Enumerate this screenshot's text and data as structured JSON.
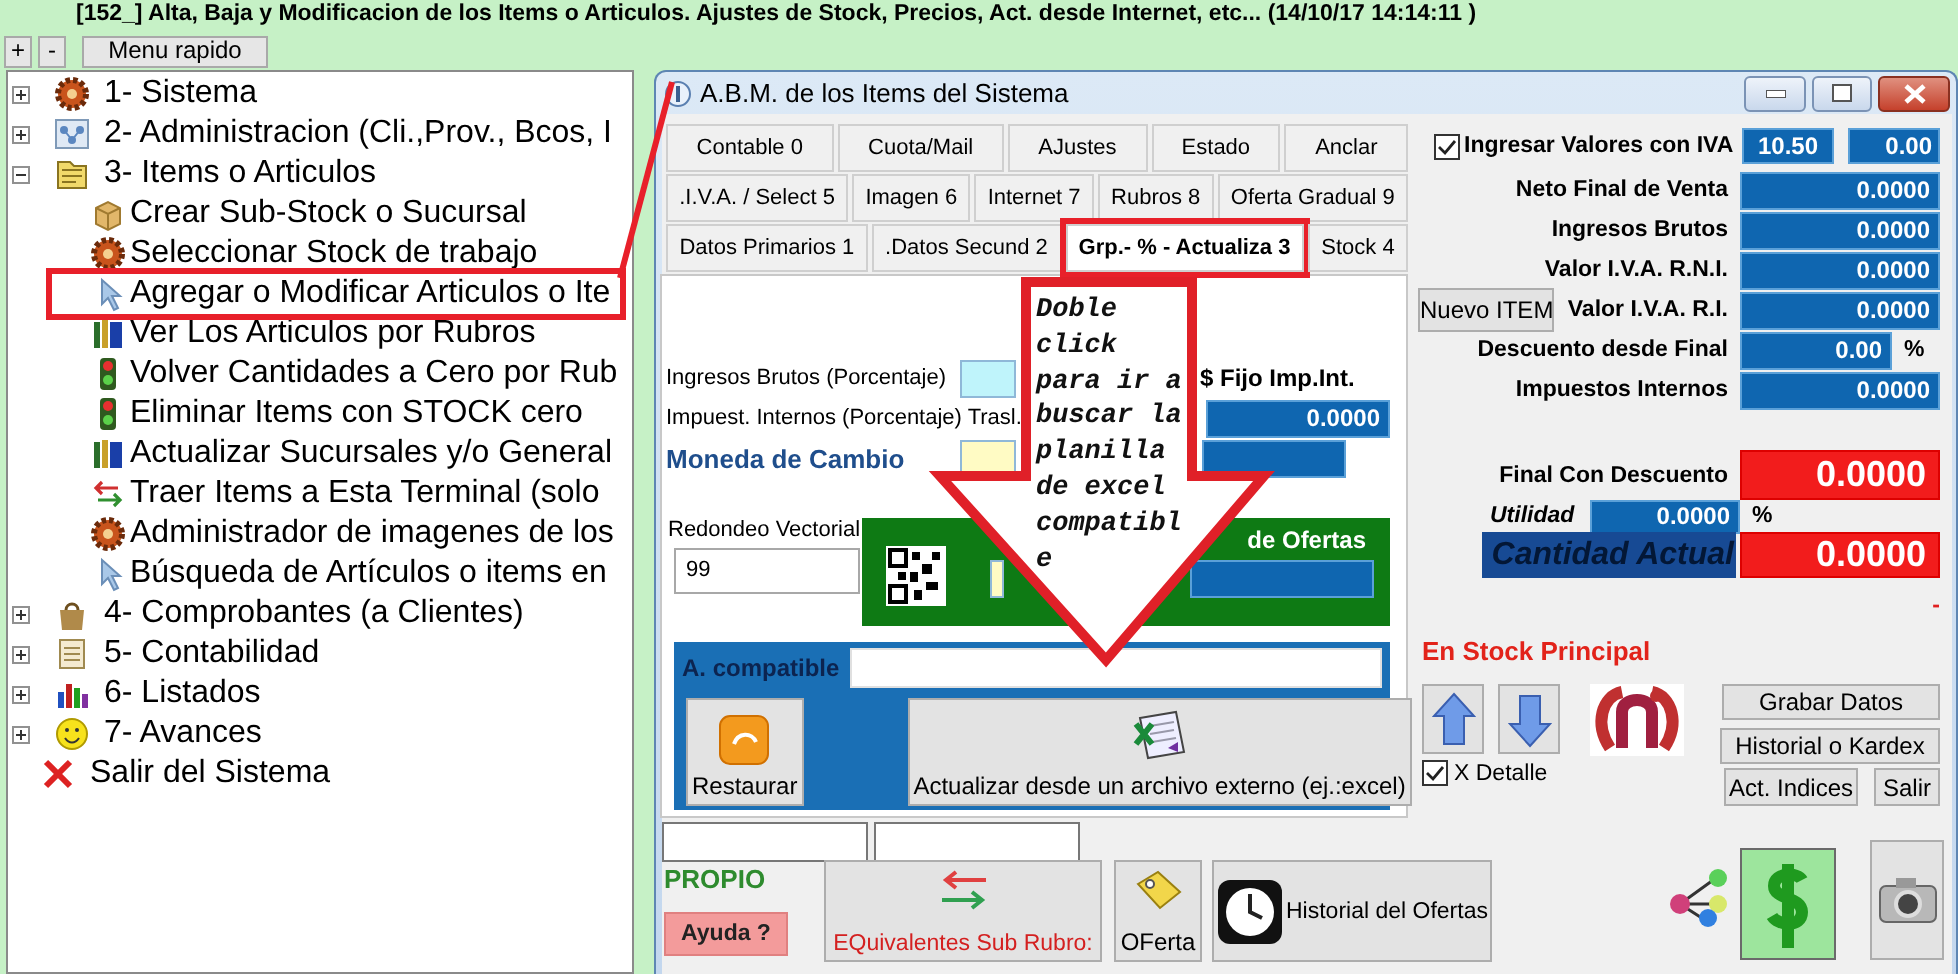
{
  "header": {
    "title": "[152_] Alta, Baja y Modificacion de los Items o Articulos. Ajustes de Stock, Precios, Act. desde Internet, etc... (14/10/17 14:14:11  )"
  },
  "toolbar": {
    "expand_all": "+",
    "collapse_all": "-",
    "quick_menu": "Menu rapido"
  },
  "tree": [
    {
      "label": "1- Sistema",
      "kind": "gear",
      "expanded": false
    },
    {
      "label": "2- Administracion (Cli.,Prov., Bcos, I",
      "kind": "network",
      "expanded": false
    },
    {
      "label": "3- Items o Articulos",
      "kind": "folder",
      "expanded": true,
      "children": [
        {
          "label": "Crear Sub-Stock o Sucursal",
          "kind": "box",
          "highlighted": false
        },
        {
          "label": "Seleccionar Stock de trabajo",
          "kind": "gear",
          "highlighted": false
        },
        {
          "label": "Agregar o Modificar Articulos o Ite",
          "kind": "pointer",
          "highlighted": true
        },
        {
          "label": "Ver Los Articulos por Rubros",
          "kind": "books",
          "highlighted": false
        },
        {
          "label": "Volver Cantidades a Cero por Rub",
          "kind": "traffic",
          "highlighted": false
        },
        {
          "label": "Eliminar Items con STOCK cero",
          "kind": "traffic",
          "highlighted": false
        },
        {
          "label": "Actualizar Sucursales y/o  General",
          "kind": "books",
          "highlighted": false
        },
        {
          "label": "Traer Items a Esta Terminal (solo",
          "kind": "transfer",
          "highlighted": false
        },
        {
          "label": "Administrador de imagenes de los",
          "kind": "gear",
          "highlighted": false
        },
        {
          "label": "Búsqueda de Artículos o items  en",
          "kind": "pointer",
          "highlighted": false
        }
      ]
    },
    {
      "label": "4- Comprobantes (a Clientes)",
      "kind": "bag",
      "expanded": false
    },
    {
      "label": "5- Contabilidad",
      "kind": "ledger",
      "expanded": false
    },
    {
      "label": "6- Listados",
      "kind": "chart",
      "expanded": false
    },
    {
      "label": "7- Avances",
      "kind": "smiley",
      "expanded": false
    },
    {
      "label": "Salir del Sistema",
      "kind": "cross"
    }
  ],
  "dialog": {
    "title": "A.B.M. de los Items del Sistema",
    "tab_rows": [
      {
        "tabs": [
          {
            "label": "Contable 0",
            "selected": false,
            "highlighted": false
          },
          {
            "label": "Cuota/Mail",
            "selected": false,
            "highlighted": false
          },
          {
            "label": "AJustes",
            "selected": false,
            "highlighted": false
          },
          {
            "label": "Estado",
            "selected": false,
            "highlighted": false
          },
          {
            "label": "Anclar",
            "selected": false,
            "highlighted": false
          }
        ]
      },
      {
        "tabs": [
          {
            "label": ".I.V.A. / Select 5",
            "selected": false,
            "highlighted": false
          },
          {
            "label": "Imagen 6",
            "selected": false,
            "highlighted": false
          },
          {
            "label": "Internet 7",
            "selected": false,
            "highlighted": false
          },
          {
            "label": "Rubros 8",
            "selected": false,
            "highlighted": false
          },
          {
            "label": "Oferta Gradual 9",
            "selected": false,
            "highlighted": false
          }
        ]
      },
      {
        "tabs": [
          {
            "label": "Datos Primarios 1",
            "selected": false,
            "highlighted": false
          },
          {
            "label": ".Datos Secund 2",
            "selected": false,
            "highlighted": false
          },
          {
            "label": "Grp.- % - Actualiza 3",
            "selected": true,
            "highlighted": true
          },
          {
            "label": "Stock 4",
            "selected": false,
            "highlighted": false
          }
        ]
      }
    ],
    "form": {
      "ingresos_brutos": {
        "label": "Ingresos Brutos (Porcentaje)"
      },
      "impuestos_internos": {
        "label": "Impuest. Internos (Porcentaje) Trasl."
      },
      "fijo_imp_int": {
        "label": "$ Fijo Imp.Int.",
        "value": "0.0000"
      },
      "moneda": {
        "label": "Moneda de Cambio"
      },
      "redondeo": {
        "label": "Redondeo Vectorial",
        "value": "99"
      },
      "ofertas": {
        "label": "de Ofertas"
      },
      "import_panel": {
        "label": "A. compatible",
        "restore": "Restaurar",
        "update": "Actualizar desde un archivo externo (ej.:excel)"
      }
    },
    "bottom": {
      "status": "PROPIO",
      "help": "Ayuda ?",
      "equivalents": "EQuivalentes Sub Rubro:",
      "offer": "OFerta",
      "history": "Historial del Ofertas"
    },
    "right": {
      "iva_checkbox": {
        "label": "Ingresar Valores con IVA",
        "checked": true
      },
      "iva_rate": "10.50",
      "iva_extra": "0.00",
      "rows": [
        {
          "label": "Neto Final de Venta",
          "value": "0.0000"
        },
        {
          "label": "Ingresos Brutos",
          "value": "0.0000"
        },
        {
          "label": "Valor I.V.A. R.N.I.",
          "value": "0.0000"
        },
        {
          "label": "Valor I.V.A. R.I.",
          "value": "0.0000",
          "button": "Nuevo ITEM"
        },
        {
          "label": "Descuento desde Final",
          "value": "0.00",
          "unit": "%"
        },
        {
          "label": "Impuestos Internos",
          "value": "0.0000"
        }
      ],
      "final": {
        "label": "Final Con Descuento",
        "value": "0.0000"
      },
      "utilidad": {
        "label": "Utilidad",
        "value": "0.0000",
        "unit": "%"
      },
      "cantidad": {
        "label": "Cantidad Actual",
        "value": "0.0000"
      },
      "dash": "-",
      "stock": "En Stock Principal",
      "save": "Grabar Datos",
      "kardex": "Historial o Kardex",
      "detail": {
        "label": "X Detalle",
        "checked": true
      },
      "indices": "Act. Indices",
      "exit": "Salir"
    }
  },
  "annotation": {
    "note": "Doble click para ir a buscar la planilla de excel compatible"
  }
}
